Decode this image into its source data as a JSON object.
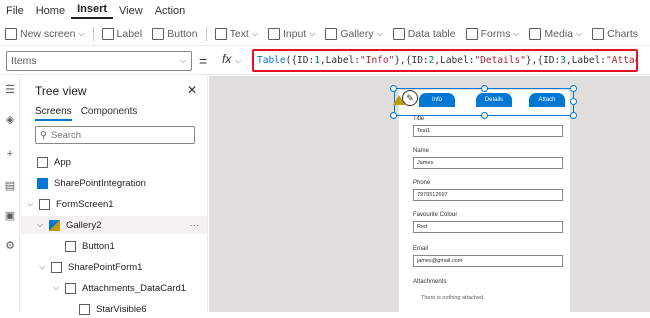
{
  "menu": {
    "items": [
      "File",
      "Home",
      "Insert",
      "View",
      "Action"
    ],
    "active": "Insert"
  },
  "ribbon": {
    "new_screen": "New screen",
    "label": "Label",
    "button": "Button",
    "text": "Text",
    "input": "Input",
    "gallery": "Gallery",
    "data_table": "Data table",
    "forms": "Forms",
    "media": "Media",
    "charts": "Charts"
  },
  "formula_bar": {
    "property": "Items",
    "equals": "=",
    "fx": "fx",
    "tokens": [
      {
        "t": "Table",
        "k": "fn"
      },
      {
        "t": "({ID:",
        "k": "plain"
      },
      {
        "t": "1",
        "k": "num"
      },
      {
        "t": ",Label:",
        "k": "plain"
      },
      {
        "t": "\"Info\"",
        "k": "str"
      },
      {
        "t": "},{ID:",
        "k": "plain"
      },
      {
        "t": "2",
        "k": "num"
      },
      {
        "t": ",Label:",
        "k": "plain"
      },
      {
        "t": "\"Details\"",
        "k": "str"
      },
      {
        "t": "},{ID:",
        "k": "plain"
      },
      {
        "t": "3",
        "k": "num"
      },
      {
        "t": ",Label:",
        "k": "plain"
      },
      {
        "t": "\"Attach\"",
        "k": "str"
      },
      {
        "t": "})",
        "k": "plain"
      }
    ]
  },
  "tree": {
    "title": "Tree view",
    "tab_screens": "Screens",
    "tab_components": "Components",
    "search_placeholder": "Search",
    "items": {
      "app": "App",
      "sharepoint": "SharePointIntegration",
      "formscreen": "FormScreen1",
      "gallery": "Gallery2",
      "button": "Button1",
      "form": "SharePointForm1",
      "datacard": "Attachments_DataCard1",
      "star": "StarVisible6"
    }
  },
  "canvas": {
    "gallery_buttons": [
      "Info",
      "Details",
      "Attach"
    ],
    "fields": [
      {
        "label": "Title",
        "value": "Test1"
      },
      {
        "label": "Name",
        "value": "James"
      },
      {
        "label": "Phone",
        "value": "7979512697"
      },
      {
        "label": "Favourite Colour",
        "value": "Red"
      },
      {
        "label": "Email",
        "value": "james@gmail.com"
      }
    ],
    "attachments_label": "Attachments",
    "attachments_note": "There is nothing attached."
  },
  "colors": {
    "accent": "#0078d4",
    "highlight_border": "#e81123",
    "warning": "#c19c00"
  }
}
